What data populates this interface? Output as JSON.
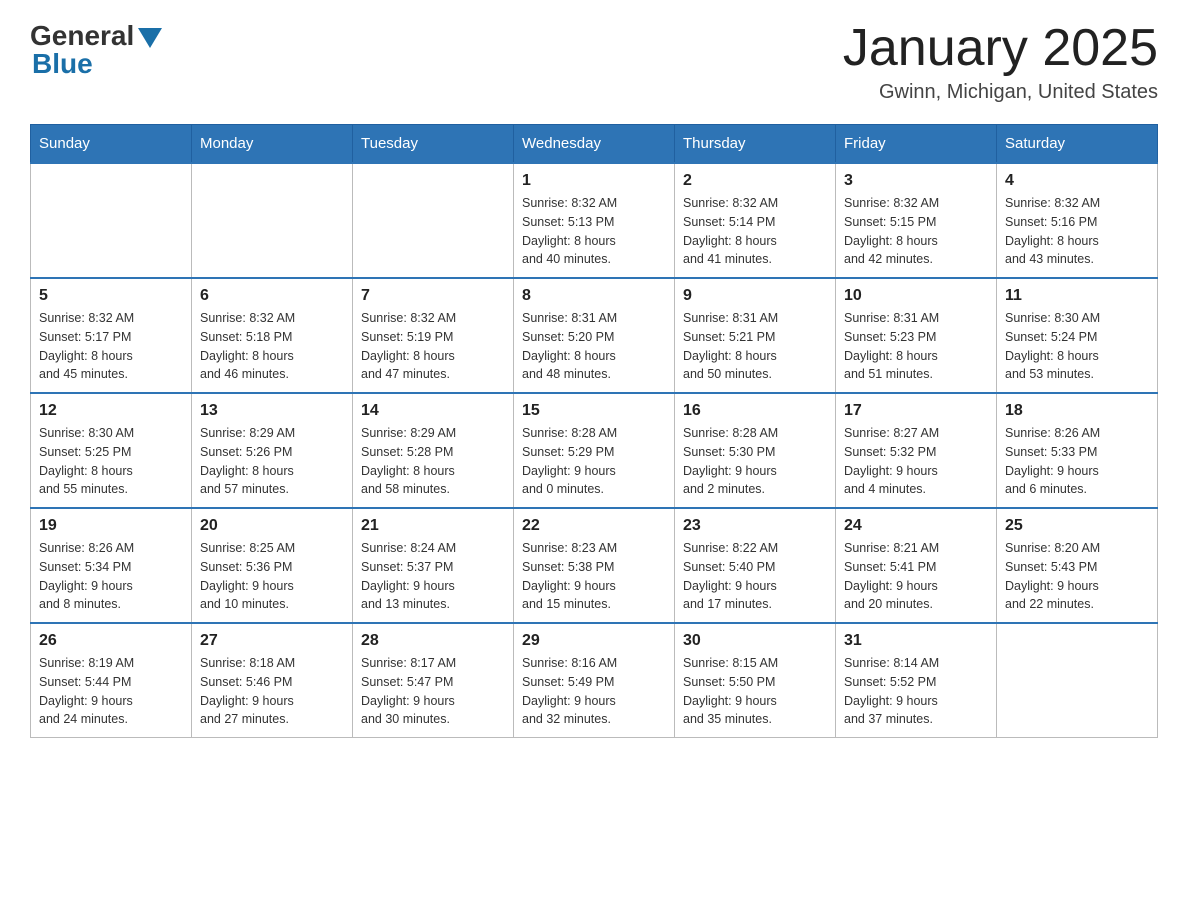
{
  "header": {
    "logo_general": "General",
    "logo_blue": "Blue",
    "month_title": "January 2025",
    "location": "Gwinn, Michigan, United States"
  },
  "weekdays": [
    "Sunday",
    "Monday",
    "Tuesday",
    "Wednesday",
    "Thursday",
    "Friday",
    "Saturday"
  ],
  "weeks": [
    [
      {
        "day": "",
        "info": ""
      },
      {
        "day": "",
        "info": ""
      },
      {
        "day": "",
        "info": ""
      },
      {
        "day": "1",
        "info": "Sunrise: 8:32 AM\nSunset: 5:13 PM\nDaylight: 8 hours\nand 40 minutes."
      },
      {
        "day": "2",
        "info": "Sunrise: 8:32 AM\nSunset: 5:14 PM\nDaylight: 8 hours\nand 41 minutes."
      },
      {
        "day": "3",
        "info": "Sunrise: 8:32 AM\nSunset: 5:15 PM\nDaylight: 8 hours\nand 42 minutes."
      },
      {
        "day": "4",
        "info": "Sunrise: 8:32 AM\nSunset: 5:16 PM\nDaylight: 8 hours\nand 43 minutes."
      }
    ],
    [
      {
        "day": "5",
        "info": "Sunrise: 8:32 AM\nSunset: 5:17 PM\nDaylight: 8 hours\nand 45 minutes."
      },
      {
        "day": "6",
        "info": "Sunrise: 8:32 AM\nSunset: 5:18 PM\nDaylight: 8 hours\nand 46 minutes."
      },
      {
        "day": "7",
        "info": "Sunrise: 8:32 AM\nSunset: 5:19 PM\nDaylight: 8 hours\nand 47 minutes."
      },
      {
        "day": "8",
        "info": "Sunrise: 8:31 AM\nSunset: 5:20 PM\nDaylight: 8 hours\nand 48 minutes."
      },
      {
        "day": "9",
        "info": "Sunrise: 8:31 AM\nSunset: 5:21 PM\nDaylight: 8 hours\nand 50 minutes."
      },
      {
        "day": "10",
        "info": "Sunrise: 8:31 AM\nSunset: 5:23 PM\nDaylight: 8 hours\nand 51 minutes."
      },
      {
        "day": "11",
        "info": "Sunrise: 8:30 AM\nSunset: 5:24 PM\nDaylight: 8 hours\nand 53 minutes."
      }
    ],
    [
      {
        "day": "12",
        "info": "Sunrise: 8:30 AM\nSunset: 5:25 PM\nDaylight: 8 hours\nand 55 minutes."
      },
      {
        "day": "13",
        "info": "Sunrise: 8:29 AM\nSunset: 5:26 PM\nDaylight: 8 hours\nand 57 minutes."
      },
      {
        "day": "14",
        "info": "Sunrise: 8:29 AM\nSunset: 5:28 PM\nDaylight: 8 hours\nand 58 minutes."
      },
      {
        "day": "15",
        "info": "Sunrise: 8:28 AM\nSunset: 5:29 PM\nDaylight: 9 hours\nand 0 minutes."
      },
      {
        "day": "16",
        "info": "Sunrise: 8:28 AM\nSunset: 5:30 PM\nDaylight: 9 hours\nand 2 minutes."
      },
      {
        "day": "17",
        "info": "Sunrise: 8:27 AM\nSunset: 5:32 PM\nDaylight: 9 hours\nand 4 minutes."
      },
      {
        "day": "18",
        "info": "Sunrise: 8:26 AM\nSunset: 5:33 PM\nDaylight: 9 hours\nand 6 minutes."
      }
    ],
    [
      {
        "day": "19",
        "info": "Sunrise: 8:26 AM\nSunset: 5:34 PM\nDaylight: 9 hours\nand 8 minutes."
      },
      {
        "day": "20",
        "info": "Sunrise: 8:25 AM\nSunset: 5:36 PM\nDaylight: 9 hours\nand 10 minutes."
      },
      {
        "day": "21",
        "info": "Sunrise: 8:24 AM\nSunset: 5:37 PM\nDaylight: 9 hours\nand 13 minutes."
      },
      {
        "day": "22",
        "info": "Sunrise: 8:23 AM\nSunset: 5:38 PM\nDaylight: 9 hours\nand 15 minutes."
      },
      {
        "day": "23",
        "info": "Sunrise: 8:22 AM\nSunset: 5:40 PM\nDaylight: 9 hours\nand 17 minutes."
      },
      {
        "day": "24",
        "info": "Sunrise: 8:21 AM\nSunset: 5:41 PM\nDaylight: 9 hours\nand 20 minutes."
      },
      {
        "day": "25",
        "info": "Sunrise: 8:20 AM\nSunset: 5:43 PM\nDaylight: 9 hours\nand 22 minutes."
      }
    ],
    [
      {
        "day": "26",
        "info": "Sunrise: 8:19 AM\nSunset: 5:44 PM\nDaylight: 9 hours\nand 24 minutes."
      },
      {
        "day": "27",
        "info": "Sunrise: 8:18 AM\nSunset: 5:46 PM\nDaylight: 9 hours\nand 27 minutes."
      },
      {
        "day": "28",
        "info": "Sunrise: 8:17 AM\nSunset: 5:47 PM\nDaylight: 9 hours\nand 30 minutes."
      },
      {
        "day": "29",
        "info": "Sunrise: 8:16 AM\nSunset: 5:49 PM\nDaylight: 9 hours\nand 32 minutes."
      },
      {
        "day": "30",
        "info": "Sunrise: 8:15 AM\nSunset: 5:50 PM\nDaylight: 9 hours\nand 35 minutes."
      },
      {
        "day": "31",
        "info": "Sunrise: 8:14 AM\nSunset: 5:52 PM\nDaylight: 9 hours\nand 37 minutes."
      },
      {
        "day": "",
        "info": ""
      }
    ]
  ]
}
